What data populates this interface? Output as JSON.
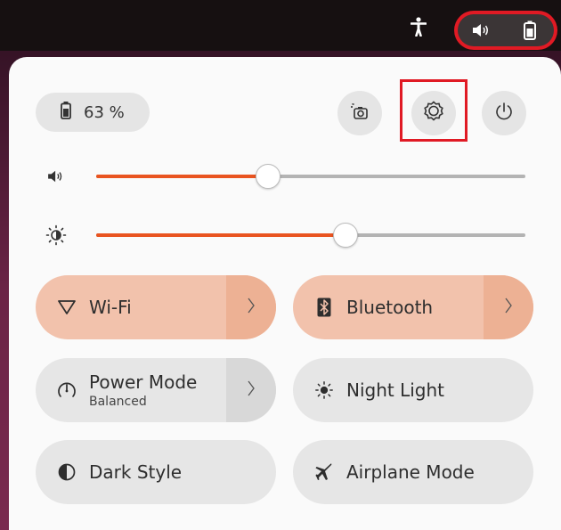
{
  "battery": {
    "percent_label": "63 %"
  },
  "sliders": {
    "volume": {
      "level": 0.4
    },
    "brightness": {
      "level": 0.58
    }
  },
  "tiles": {
    "wifi": {
      "label": "Wi-Fi",
      "active": true
    },
    "bluetooth": {
      "label": "Bluetooth",
      "active": true
    },
    "power_mode": {
      "label": "Power Mode",
      "sublabel": "Balanced"
    },
    "night_light": {
      "label": "Night Light"
    },
    "dark_style": {
      "label": "Dark Style"
    },
    "airplane_mode": {
      "label": "Airplane Mode"
    }
  },
  "colors": {
    "accent": "#e95420",
    "highlight_box": "#e01a24",
    "active_tile": "#f2c2ac"
  },
  "icons": {
    "topbar": [
      "accessibility-icon",
      "volume-icon",
      "battery-icon"
    ],
    "header": [
      "screenshot-icon",
      "settings-icon",
      "power-icon"
    ]
  }
}
